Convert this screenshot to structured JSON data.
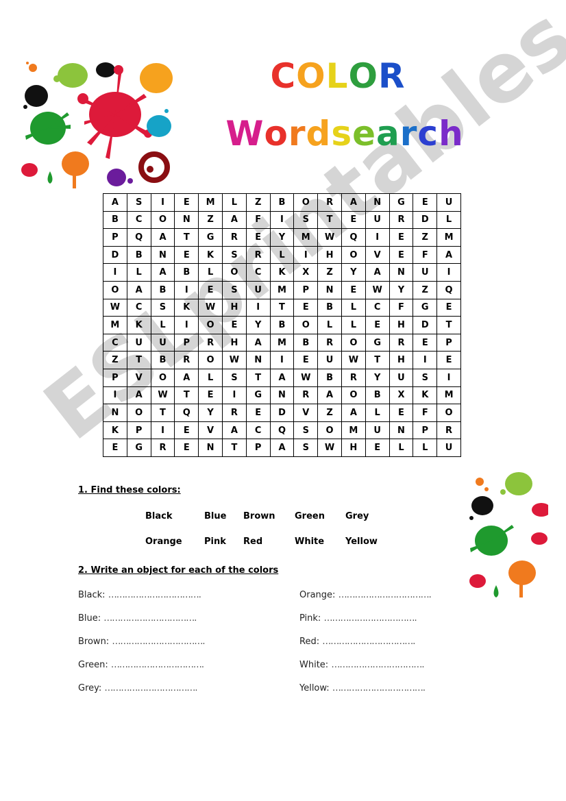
{
  "title": {
    "line1": [
      "C",
      "O",
      "L",
      "O",
      "R"
    ],
    "line1_colors": [
      "#e8312b",
      "#f6a21e",
      "#e6d21a",
      "#2e9e3e",
      "#1b4fc9"
    ],
    "line2": [
      "W",
      "o",
      "r",
      "d",
      "s",
      "e",
      "a",
      "r",
      "c",
      "h"
    ],
    "line2_colors": [
      "#d61e8c",
      "#e8312b",
      "#f07a1e",
      "#f6a21e",
      "#e6d21a",
      "#7bbf2a",
      "#1f9e50",
      "#1b6fc9",
      "#2b3fd1",
      "#7a2bc9"
    ]
  },
  "grid": [
    [
      "A",
      "S",
      "I",
      "E",
      "M",
      "L",
      "Z",
      "B",
      "O",
      "R",
      "A",
      "N",
      "G",
      "E",
      "U"
    ],
    [
      "B",
      "C",
      "O",
      "N",
      "Z",
      "A",
      "F",
      "I",
      "S",
      "T",
      "E",
      "U",
      "R",
      "D",
      "L"
    ],
    [
      "P",
      "Q",
      "A",
      "T",
      "G",
      "R",
      "E",
      "Y",
      "M",
      "W",
      "Q",
      "I",
      "E",
      "Z",
      "M"
    ],
    [
      "D",
      "B",
      "N",
      "E",
      "K",
      "S",
      "R",
      "L",
      "I",
      "H",
      "O",
      "V",
      "E",
      "F",
      "A"
    ],
    [
      "I",
      "L",
      "A",
      "B",
      "L",
      "O",
      "C",
      "K",
      "X",
      "Z",
      "Y",
      "A",
      "N",
      "U",
      "I"
    ],
    [
      "O",
      "A",
      "B",
      "I",
      "E",
      "S",
      "U",
      "M",
      "P",
      "N",
      "E",
      "W",
      "Y",
      "Z",
      "Q"
    ],
    [
      "W",
      "C",
      "S",
      "K",
      "W",
      "H",
      "I",
      "T",
      "E",
      "B",
      "L",
      "C",
      "F",
      "G",
      "E"
    ],
    [
      "M",
      "K",
      "L",
      "I",
      "O",
      "E",
      "Y",
      "B",
      "O",
      "L",
      "L",
      "E",
      "H",
      "D",
      "T"
    ],
    [
      "C",
      "U",
      "U",
      "P",
      "R",
      "H",
      "A",
      "M",
      "B",
      "R",
      "O",
      "G",
      "R",
      "E",
      "P"
    ],
    [
      "Z",
      "T",
      "B",
      "R",
      "O",
      "W",
      "N",
      "I",
      "E",
      "U",
      "W",
      "T",
      "H",
      "I",
      "E"
    ],
    [
      "P",
      "V",
      "O",
      "A",
      "L",
      "S",
      "T",
      "A",
      "W",
      "B",
      "R",
      "Y",
      "U",
      "S",
      "I"
    ],
    [
      "I",
      "A",
      "W",
      "T",
      "E",
      "I",
      "G",
      "N",
      "R",
      "A",
      "O",
      "B",
      "X",
      "K",
      "M"
    ],
    [
      "N",
      "O",
      "T",
      "Q",
      "Y",
      "R",
      "E",
      "D",
      "V",
      "Z",
      "A",
      "L",
      "E",
      "F",
      "O"
    ],
    [
      "K",
      "P",
      "I",
      "E",
      "V",
      "A",
      "C",
      "Q",
      "S",
      "O",
      "M",
      "U",
      "N",
      "P",
      "R"
    ],
    [
      "E",
      "G",
      "R",
      "E",
      "N",
      "T",
      "P",
      "A",
      "S",
      "W",
      "H",
      "E",
      "L",
      "L",
      "U"
    ]
  ],
  "section1": {
    "heading": "1.  Find these colors:",
    "words": [
      "Black",
      "Blue",
      "Brown",
      "Green",
      "Grey",
      "Orange",
      "Pink",
      "Red",
      "White",
      "Yellow"
    ]
  },
  "section2": {
    "heading": "2.  Write an object for each of the colors",
    "left": [
      "Black:",
      "Blue:",
      "Brown:",
      "Green:",
      "Grey:"
    ],
    "right": [
      "Orange:",
      "Pink:",
      "Red:",
      "White:",
      "Yellow:"
    ],
    "blank": "……………………………."
  },
  "watermark": "ESLprintables.com"
}
